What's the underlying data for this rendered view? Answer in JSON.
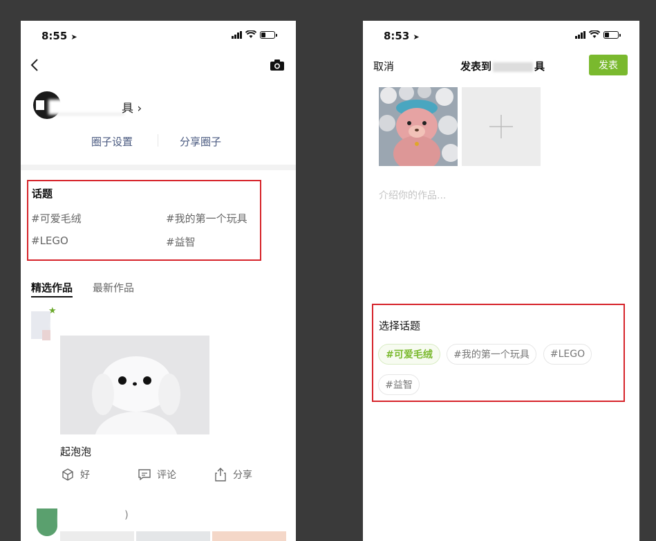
{
  "left": {
    "status_time": "8:55",
    "profile_suffix": "具",
    "circle_settings": "圈子设置",
    "share_circle": "分享圈子",
    "topics_title": "话题",
    "topics": [
      "#可爱毛绒",
      "#我的第一个玩具",
      "#LEGO",
      "#益智"
    ],
    "tabs": [
      "精选作品",
      "最新作品"
    ],
    "post_title": "起泡泡",
    "actions": [
      "好",
      "评论",
      "分享"
    ]
  },
  "right": {
    "status_time": "8:53",
    "cancel": "取消",
    "header_title": "发表到",
    "header_suffix": "具",
    "publish": "发表",
    "placeholder": "介绍你的作品...",
    "choose_topic": "选择话题",
    "topics": [
      "#可爱毛绒",
      "#我的第一个玩具",
      "#LEGO",
      "#益智"
    ],
    "selected_topic": "#可爱毛绒"
  },
  "colors": {
    "accent_green": "#7ab92e",
    "highlight_red": "#d6232a"
  }
}
